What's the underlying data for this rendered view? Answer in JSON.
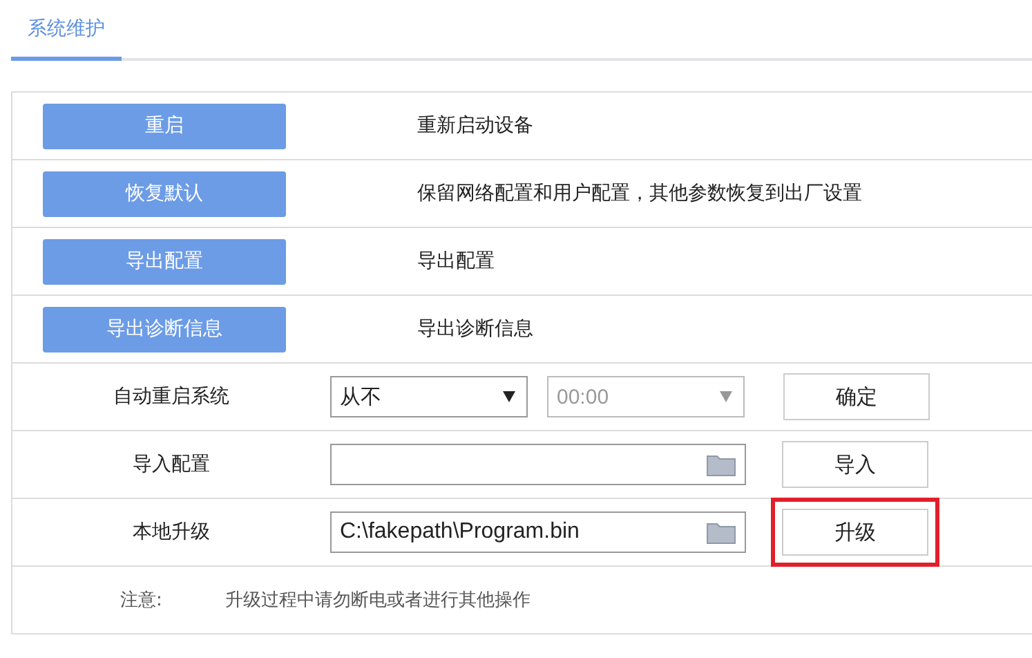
{
  "tabs": [
    {
      "label": "系统维护",
      "selected": true
    }
  ],
  "actions": [
    {
      "button": "重启",
      "description": "重新启动设备"
    },
    {
      "button": "恢复默认",
      "description": "保留网络配置和用户配置，其他参数恢复到出厂设置"
    },
    {
      "button": "导出配置",
      "description": "导出配置"
    },
    {
      "button": "导出诊断信息",
      "description": "导出诊断信息"
    }
  ],
  "settings": [
    {
      "kind": "schedule",
      "label": "自动重启系统",
      "select": {
        "value": "从不",
        "disabled": false
      },
      "time": {
        "value": "00:00",
        "disabled": true
      },
      "button": {
        "label": "确定",
        "highlighted": false
      }
    },
    {
      "kind": "file",
      "label": "导入配置",
      "button": {
        "label": "导入",
        "highlighted": false
      }
    },
    {
      "kind": "file",
      "label": "本地升级",
      "file": {
        "value": "C:\\fakepath\\Program.bin"
      },
      "button": {
        "label": "升级",
        "highlighted": true
      }
    }
  ],
  "note": {
    "label": "注意:",
    "text": "升级过程中请勿断电或者进行其他操作"
  }
}
